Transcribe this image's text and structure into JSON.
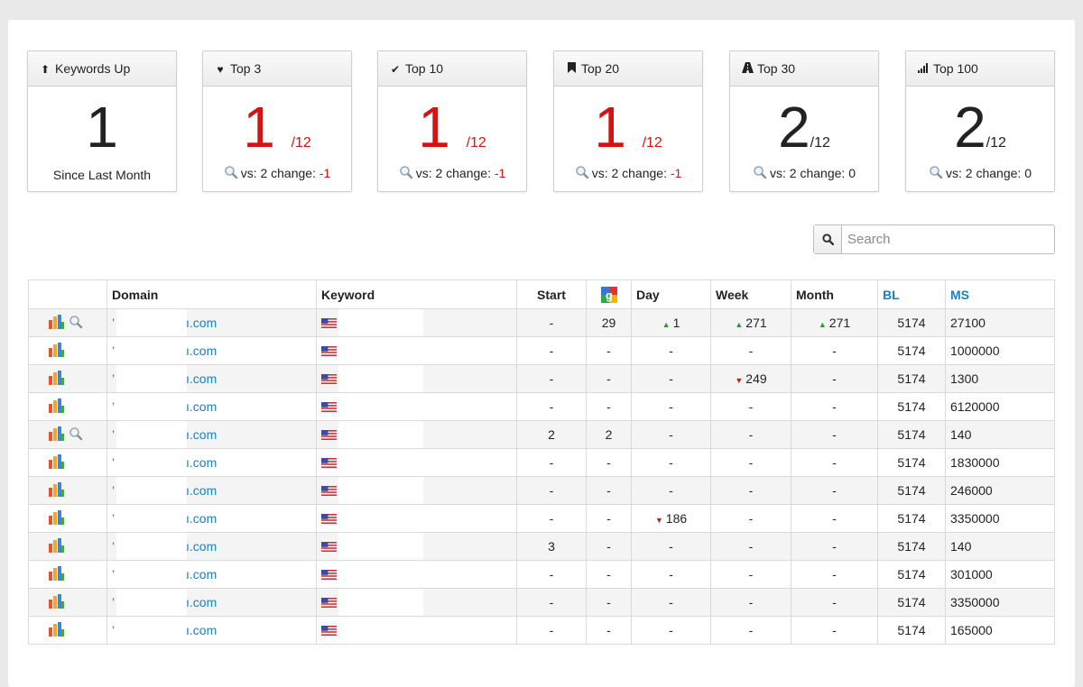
{
  "cards": [
    {
      "icon": "arrow-up-icon",
      "title": "Keywords Up",
      "value": "1",
      "denominator": "",
      "footer_text": "Since Last Month",
      "footer_change": "",
      "change_red": false,
      "value_red": false
    },
    {
      "icon": "heart-icon",
      "title": "Top 3",
      "value": "1",
      "denominator": "/12",
      "footer_text": "vs: 2 change: ",
      "footer_change": "-1",
      "change_red": true,
      "value_red": true
    },
    {
      "icon": "checkmark-icon",
      "title": "Top 10",
      "value": "1",
      "denominator": "/12",
      "footer_text": "vs: 2 change: ",
      "footer_change": "-1",
      "change_red": true,
      "value_red": true
    },
    {
      "icon": "bookmark-icon",
      "title": "Top 20",
      "value": "1",
      "denominator": "/12",
      "footer_text": "vs: 2 change: ",
      "footer_change": "-1",
      "change_red": true,
      "value_red": true
    },
    {
      "icon": "road-icon",
      "title": "Top 30",
      "value": "2",
      "denominator": "/12",
      "footer_text": "vs: 2 change: ",
      "footer_change": "0",
      "change_red": false,
      "value_red": false
    },
    {
      "icon": "signal-icon",
      "title": "Top 100",
      "value": "2",
      "denominator": "/12",
      "footer_text": "vs: 2 change: ",
      "footer_change": "0",
      "change_red": false,
      "value_red": false
    }
  ],
  "search": {
    "placeholder": "Search"
  },
  "table": {
    "headers": {
      "domain": "Domain",
      "keyword": "Keyword",
      "start": "Start",
      "google": "google-icon",
      "day": "Day",
      "week": "Week",
      "month": "Month",
      "bl": "BL",
      "ms": "MS"
    },
    "rows": [
      {
        "has_search": true,
        "domain": "’                               ı.com",
        "start": "-",
        "google": "29",
        "day": {
          "dir": "up",
          "val": "1"
        },
        "week": {
          "dir": "up",
          "val": "271"
        },
        "month": {
          "dir": "up",
          "val": "271"
        },
        "bl": "5174",
        "ms": "27100"
      },
      {
        "has_search": false,
        "domain": "ı.com",
        "start": "-",
        "google": "-",
        "day": {
          "dir": "",
          "val": "-"
        },
        "week": {
          "dir": "",
          "val": "-"
        },
        "month": {
          "dir": "",
          "val": "-"
        },
        "bl": "5174",
        "ms": "1000000"
      },
      {
        "has_search": false,
        "domain": "ı.com",
        "start": "-",
        "google": "-",
        "day": {
          "dir": "",
          "val": "-"
        },
        "week": {
          "dir": "down",
          "val": "249"
        },
        "month": {
          "dir": "",
          "val": "-"
        },
        "bl": "5174",
        "ms": "1300"
      },
      {
        "has_search": false,
        "domain": "ı.com",
        "start": "-",
        "google": "-",
        "day": {
          "dir": "",
          "val": "-"
        },
        "week": {
          "dir": "",
          "val": "-"
        },
        "month": {
          "dir": "",
          "val": "-"
        },
        "bl": "5174",
        "ms": "6120000"
      },
      {
        "has_search": true,
        "domain": "ı.com",
        "start": "2",
        "google": "2",
        "day": {
          "dir": "",
          "val": "-"
        },
        "week": {
          "dir": "",
          "val": "-"
        },
        "month": {
          "dir": "",
          "val": "-"
        },
        "bl": "5174",
        "ms": "140"
      },
      {
        "has_search": false,
        "domain": "ı.com",
        "start": "-",
        "google": "-",
        "day": {
          "dir": "",
          "val": "-"
        },
        "week": {
          "dir": "",
          "val": "-"
        },
        "month": {
          "dir": "",
          "val": "-"
        },
        "bl": "5174",
        "ms": "1830000"
      },
      {
        "has_search": false,
        "domain": "ı.com",
        "start": "-",
        "google": "-",
        "day": {
          "dir": "",
          "val": "-"
        },
        "week": {
          "dir": "",
          "val": "-"
        },
        "month": {
          "dir": "",
          "val": "-"
        },
        "bl": "5174",
        "ms": "246000"
      },
      {
        "has_search": false,
        "domain": "ı.com",
        "start": "-",
        "google": "-",
        "day": {
          "dir": "down",
          "val": "186"
        },
        "week": {
          "dir": "",
          "val": "-"
        },
        "month": {
          "dir": "",
          "val": "-"
        },
        "bl": "5174",
        "ms": "3350000"
      },
      {
        "has_search": false,
        "domain": "ı.com",
        "start": "3",
        "google": "-",
        "day": {
          "dir": "",
          "val": "-"
        },
        "week": {
          "dir": "",
          "val": "-"
        },
        "month": {
          "dir": "",
          "val": "-"
        },
        "bl": "5174",
        "ms": "140"
      },
      {
        "has_search": false,
        "domain": "ı.com",
        "start": "-",
        "google": "-",
        "day": {
          "dir": "",
          "val": "-"
        },
        "week": {
          "dir": "",
          "val": "-"
        },
        "month": {
          "dir": "",
          "val": "-"
        },
        "bl": "5174",
        "ms": "301000"
      },
      {
        "has_search": false,
        "domain": "ı.com",
        "start": "-",
        "google": "-",
        "day": {
          "dir": "",
          "val": "-"
        },
        "week": {
          "dir": "",
          "val": "-"
        },
        "month": {
          "dir": "",
          "val": "-"
        },
        "bl": "5174",
        "ms": "3350000"
      },
      {
        "has_search": false,
        "domain": "ı.com",
        "start": "-",
        "google": "-",
        "day": {
          "dir": "",
          "val": "-"
        },
        "week": {
          "dir": "",
          "val": "-"
        },
        "month": {
          "dir": "",
          "val": "-"
        },
        "bl": "5174",
        "ms": "165000"
      }
    ]
  },
  "colors": {
    "accent": "#1a7fc4",
    "negative": "#d41313",
    "up_arrow": "#2f9a35",
    "down_arrow": "#c31a1a"
  }
}
